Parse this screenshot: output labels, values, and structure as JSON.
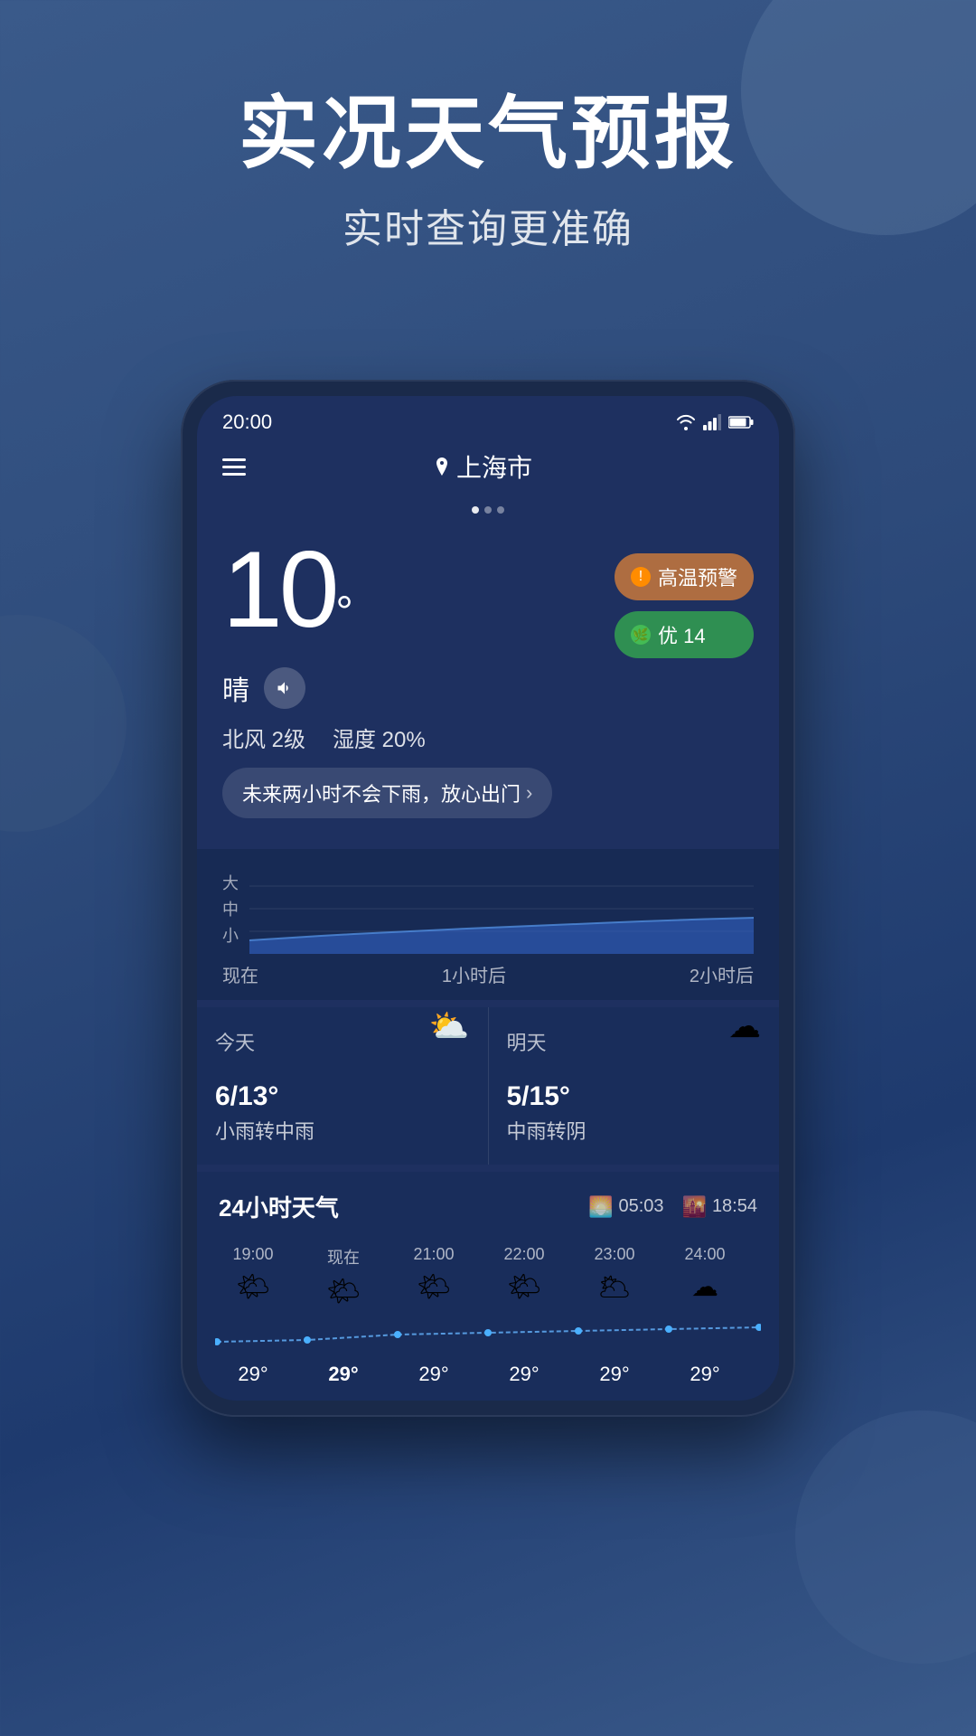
{
  "hero": {
    "title": "实况天气预报",
    "subtitle": "实时查询更准确"
  },
  "status_bar": {
    "time": "20:00"
  },
  "nav": {
    "city": "上海市"
  },
  "weather": {
    "temperature": "10",
    "condition": "晴",
    "wind": "北风 2级",
    "humidity": "湿度 20%",
    "rain_forecast": "未来两小时不会下雨，放心出门",
    "alerts": {
      "heat_warning": "高温预警",
      "aqi_label": "优 14"
    }
  },
  "chart": {
    "y_labels": [
      "大",
      "中",
      "小"
    ],
    "x_labels": [
      "现在",
      "1小时后",
      "2小时后"
    ]
  },
  "daily": {
    "today": {
      "label": "今天",
      "temp": "6/13°",
      "desc": "小雨转中雨"
    },
    "tomorrow": {
      "label": "明天",
      "temp": "5/15°",
      "desc": "中雨转阴"
    }
  },
  "hourly": {
    "title": "24小时天气",
    "sunrise": "05:03",
    "sunset": "18:54",
    "items": [
      {
        "time": "19:00",
        "icon": "🌤",
        "temp": "29°"
      },
      {
        "time": "现在",
        "icon": "🌤",
        "temp": "29°"
      },
      {
        "time": "21:00",
        "icon": "🌤",
        "temp": "29°"
      },
      {
        "time": "22:00",
        "icon": "🌤",
        "temp": "29°"
      },
      {
        "time": "23:00",
        "icon": "🌥",
        "temp": "29°"
      },
      {
        "time": "24:00",
        "icon": "☁",
        "temp": "29°"
      }
    ]
  }
}
